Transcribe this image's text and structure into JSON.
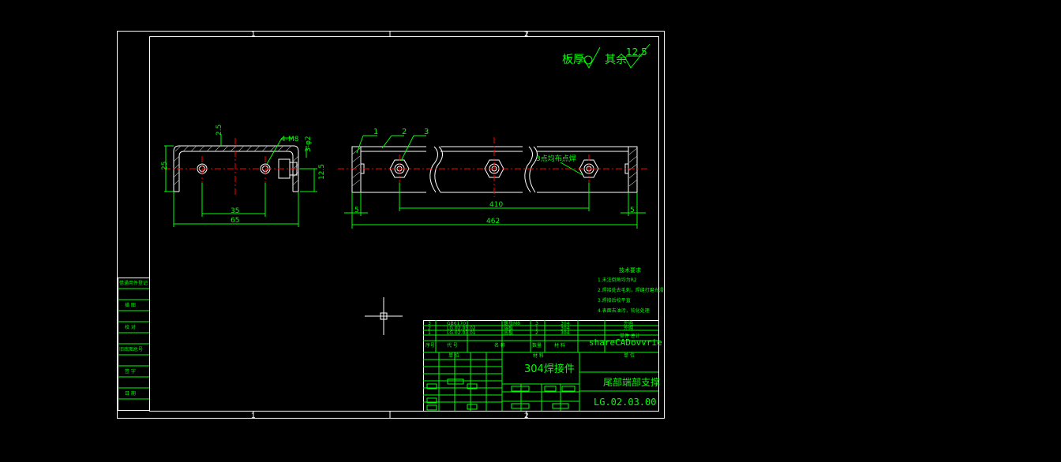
{
  "colors": {
    "background": "#000000",
    "border": "#ffffff",
    "geometry": "#ffffff",
    "dimension": "#00ff00",
    "centerline": "#ff0000",
    "hatch": "#b0b0b0",
    "text": "#00ff00",
    "cursor": "#ffffff"
  },
  "zone_labels": {
    "top": [
      "1",
      "2"
    ],
    "bottom": [
      "1",
      "2"
    ]
  },
  "roughness": {
    "plate": "板厚",
    "other": "其余",
    "value": "12.5"
  },
  "side_view": {
    "callout_holes": "4-M8",
    "callout_holes2": "3-φ2",
    "dim_top": "2.5",
    "dim_height": "25",
    "dim_right": "12.5",
    "dim_hole_spacing": "35",
    "dim_width": "65"
  },
  "front_view": {
    "balloons": [
      "1",
      "2",
      "3"
    ],
    "note_weld": "3点均布点焊",
    "dim_left": "5",
    "dim_right": "5",
    "dim_span": "410",
    "dim_total": "462"
  },
  "tech_req": {
    "title": "技术要求",
    "items": [
      "1.未注倒角均为R2",
      "2.焊接处去毛刺，焊缝打磨光滑",
      "3.焊接后校平直",
      "4.表面去油污，钝化处理"
    ]
  },
  "left_sidebar": [
    "借通用件登记",
    "描 图",
    "校 对",
    "旧底图总号",
    "签 字",
    "日 期"
  ],
  "bom": {
    "rows": [
      {
        "no": "3",
        "code": "GB6170",
        "name": "螺母M8",
        "qty": "3",
        "mat": "304",
        "note": "外购"
      },
      {
        "no": "2",
        "code": "LG.02.03.02",
        "name": "端板",
        "qty": "1",
        "mat": "304",
        "note": "外购"
      },
      {
        "no": "1",
        "code": "LG.02.03.01",
        "name": "底板",
        "qty": "2",
        "mat": "304",
        "note": ""
      }
    ],
    "header": [
      "序号",
      "代 号",
      "名 称",
      "数量",
      "材 料",
      "重 量",
      "备 注"
    ],
    "weight_label": "单件 总计"
  },
  "title_block": {
    "company": "shareCADovvrie",
    "material": "304焊接件",
    "drawing_name": "尾部端部支撑",
    "drawing_no": "LG.02.03.00",
    "material_header": "材 料",
    "unit_header": "单 位"
  }
}
